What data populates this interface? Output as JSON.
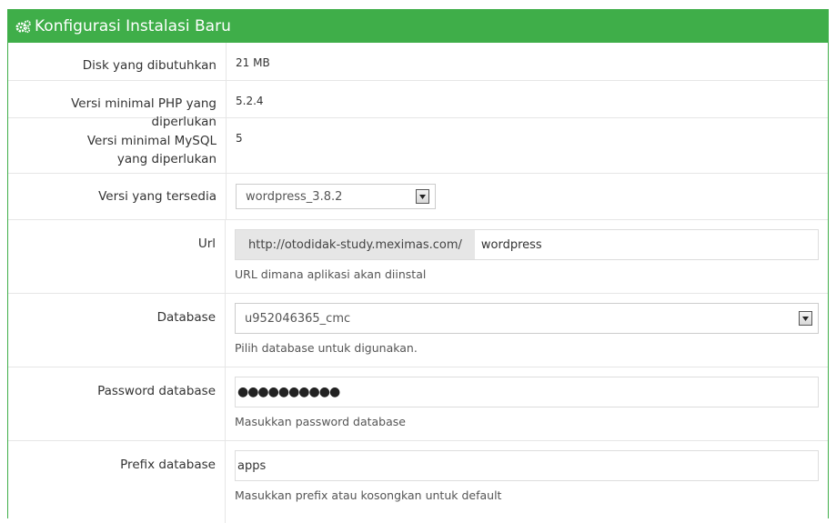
{
  "panel": {
    "title": "Konfigurasi Instalasi Baru",
    "icon": "gears-icon",
    "accent_color": "#3fae49"
  },
  "rows": {
    "disk": {
      "label": "Disk yang dibutuhkan",
      "value": "21 MB"
    },
    "php": {
      "label": "Versi minimal PHP yang diperlukan",
      "value": "5.2.4"
    },
    "mysql": {
      "label": "Versi minimal MySQL yang diperlukan",
      "value": "5"
    },
    "version": {
      "label": "Versi yang tersedia",
      "selected": "wordpress_3.8.2"
    },
    "url": {
      "label": "Url",
      "prefix": "http://otodidak-study.meximas.com/",
      "value": "wordpress",
      "help": "URL dimana aplikasi akan diinstal"
    },
    "database": {
      "label": "Database",
      "selected": "u952046365_cmc",
      "help": "Pilih database untuk digunakan."
    },
    "password": {
      "label": "Password database",
      "value": "●●●●●●●●●●",
      "help": "Masukkan password database"
    },
    "prefix": {
      "label": "Prefix database",
      "value": "apps",
      "help": "Masukkan prefix atau kosongkan untuk default"
    }
  }
}
